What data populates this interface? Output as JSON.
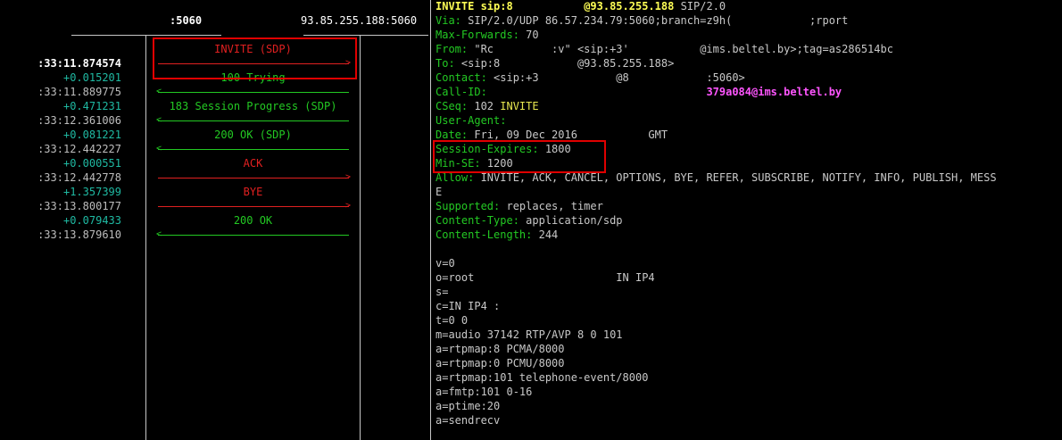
{
  "header": {
    "col1": ":5060",
    "col2": "93.85.255.188:5060"
  },
  "flow": {
    "times": [
      {
        "text": ":33:11.874574",
        "style": "white"
      },
      {
        "text": "+0.015201",
        "style": "cyan"
      },
      {
        "text": ":33:11.889775",
        "style": "gray"
      },
      {
        "text": "+0.471231",
        "style": "cyan"
      },
      {
        "text": ":33:12.361006",
        "style": "gray"
      },
      {
        "text": "+0.081221",
        "style": "cyan"
      },
      {
        "text": ":33:12.442227",
        "style": "gray"
      },
      {
        "text": "+0.000551",
        "style": "cyan"
      },
      {
        "text": ":33:12.442778",
        "style": "gray"
      },
      {
        "text": "+1.357399",
        "style": "cyan"
      },
      {
        "text": ":33:13.800177",
        "style": "gray"
      },
      {
        "text": "+0.079433",
        "style": "cyan"
      },
      {
        "text": ":33:13.879610",
        "style": "gray"
      }
    ],
    "messages": [
      {
        "label": "INVITE (SDP)",
        "color": "#e02020",
        "dir": "right"
      },
      {
        "label": "100 Trying",
        "color": "#23c923",
        "dir": "left"
      },
      {
        "label": "183 Session Progress (SDP)",
        "color": "#23c923",
        "dir": "left"
      },
      {
        "label": "200 OK (SDP)",
        "color": "#23c923",
        "dir": "left"
      },
      {
        "label": "ACK",
        "color": "#e02020",
        "dir": "right"
      },
      {
        "label": "BYE",
        "color": "#e02020",
        "dir": "right"
      },
      {
        "label": "200 OK",
        "color": "#23c923",
        "dir": "left"
      }
    ]
  },
  "sip": {
    "request_line": {
      "method": "INVITE sip:8",
      "host": "@93.85.255.188",
      "version": " SIP/2.0"
    },
    "headers": [
      {
        "key": "Via:",
        "value": " SIP/2.0/UDP 86.57.234.79:5060;branch=z9h(            ;rport"
      },
      {
        "key": "Max-Forwards:",
        "value": " 70"
      },
      {
        "key": "From:",
        "value": " \"Rc         :v\" <sip:+3'           @ims.beltel.by>;tag=as286514bc"
      },
      {
        "key": "To:",
        "value": " <sip:8            @93.85.255.188>"
      },
      {
        "key": "Contact:",
        "value": " <sip:+3            @8            :5060>"
      },
      {
        "key": "Call-ID:",
        "value": "                                  ",
        "extra": "379a084@ims.beltel.by"
      },
      {
        "key": "CSeq:",
        "value": " 102 ",
        "extra2": "INVITE"
      },
      {
        "key": "User-Agent:",
        "value": ""
      },
      {
        "key": "Date:",
        "value": " Fri, 09 Dec 2016           GMT"
      },
      {
        "key": "Session-Expires:",
        "value": " 1800"
      },
      {
        "key": "Min-SE:",
        "value": " 1200"
      },
      {
        "key": "Allow:",
        "value": " INVITE, ACK, CANCEL, OPTIONS, BYE, REFER, SUBSCRIBE, NOTIFY, INFO, PUBLISH, MESS"
      },
      {
        "key": "E",
        "value": ""
      },
      {
        "key": "Supported:",
        "value": " replaces, timer"
      },
      {
        "key": "Content-Type:",
        "value": " application/sdp"
      },
      {
        "key": "Content-Length:",
        "value": " 244"
      }
    ],
    "sdp": [
      "v=0",
      "o=root                      IN IP4",
      "s=",
      "c=IN IP4 :",
      "t=0 0",
      "m=audio 37142 RTP/AVP 8 0 101",
      "a=rtpmap:8 PCMA/8000",
      "a=rtpmap:0 PCMU/8000",
      "a=rtpmap:101 telephone-event/8000",
      "a=fmtp:101 0-16",
      "a=ptime:20",
      "a=sendrecv"
    ]
  }
}
